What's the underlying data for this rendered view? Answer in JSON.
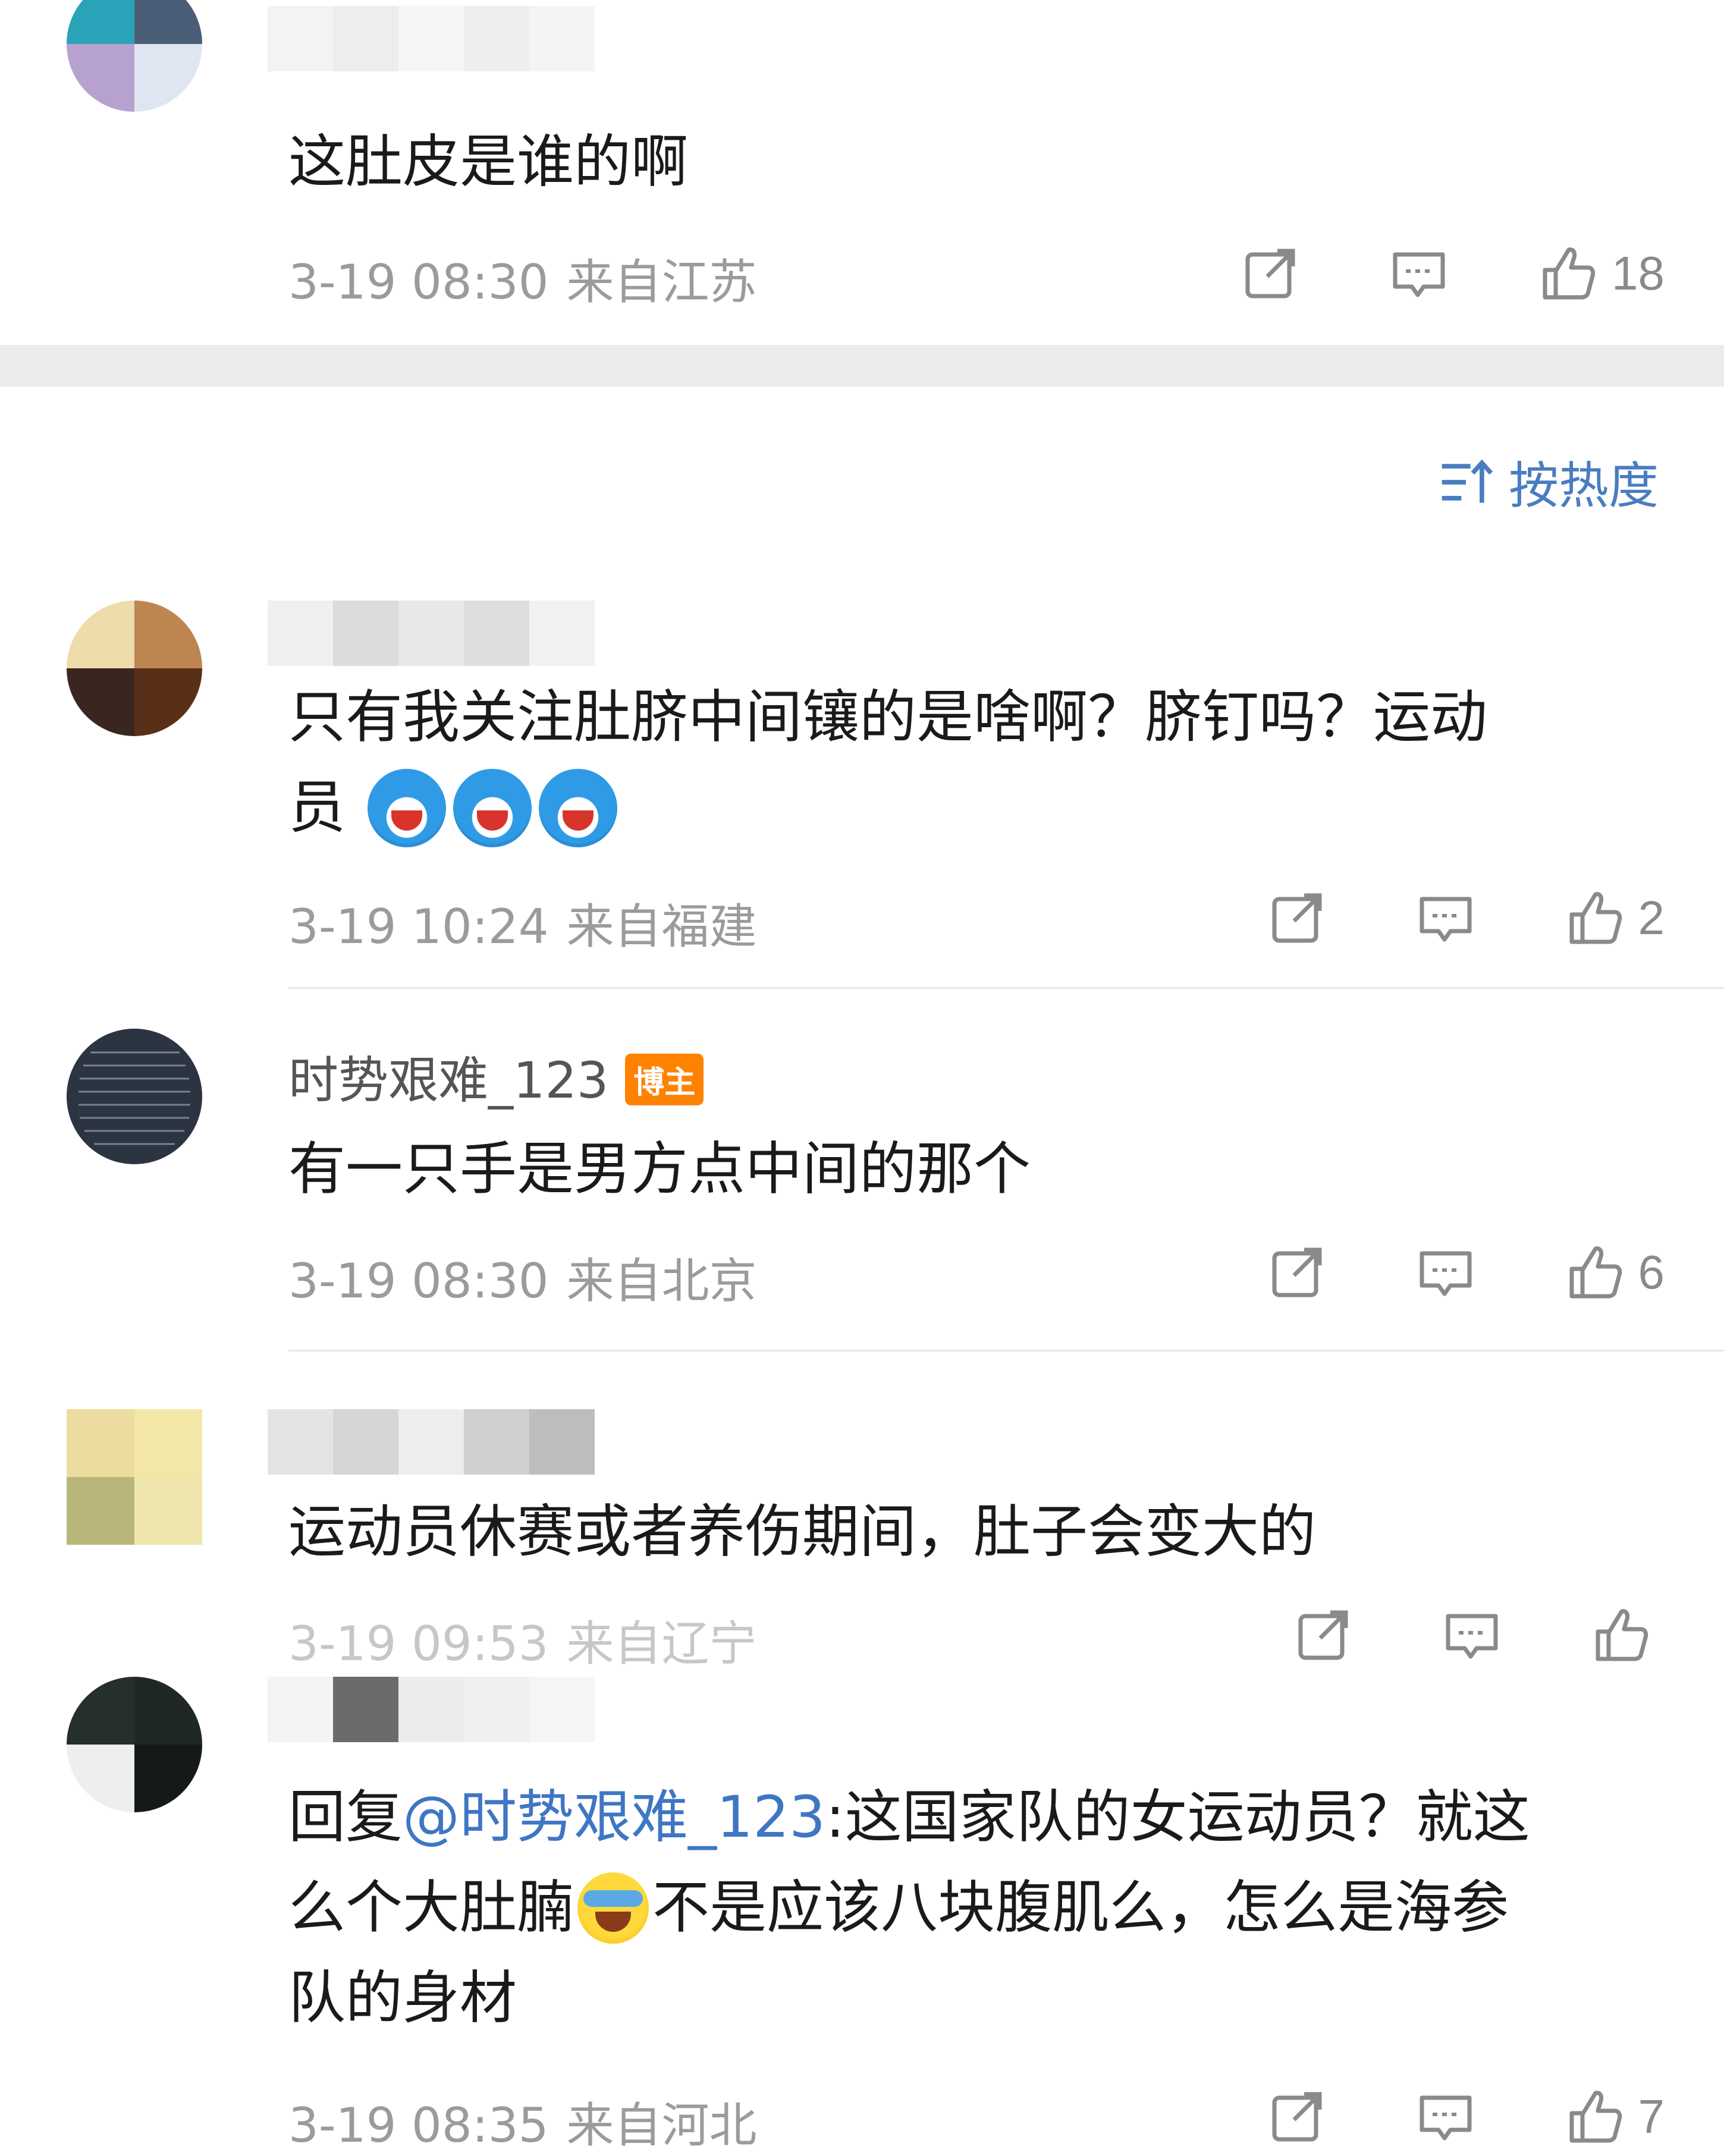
{
  "sort": {
    "label": "按热度",
    "icon": "sort-icon"
  },
  "comments": [
    {
      "username": "",
      "text": "这肚皮是谁的啊",
      "date": "3-19 08:30",
      "location": "来自江苏",
      "likes": "18"
    },
    {
      "username": "",
      "text_line1": "只有我关注肚脐中间镶的是啥啊？脐钉吗？运动",
      "text_line2": "员",
      "date": "3-19 10:24",
      "location": "来自福建",
      "likes": "2"
    },
    {
      "username": "时势艰难_123",
      "badge": "博主",
      "text": "有一只手是男方点中间的那个",
      "date": "3-19 08:30",
      "location": "来自北京",
      "likes": "6"
    },
    {
      "username": "",
      "text": "运动员休赛或者养伤期间，肚子会变大的",
      "date": "3-19 09:53",
      "location": "来自辽宁",
      "likes": ""
    },
    {
      "username": "",
      "reply_prefix": "回复",
      "mention": "@时势艰难_123",
      "text_part1": ":这国家队的女运动员？就这",
      "text_part2": "么个大肚腩",
      "text_part3": "不是应该八块腹肌么，怎么是海参",
      "text_part4": "队的身材",
      "date": "3-19 08:35",
      "location": "来自河北",
      "likes": "7"
    }
  ],
  "icons": {
    "share": "share-icon",
    "comment": "comment-icon",
    "like": "like-icon"
  }
}
